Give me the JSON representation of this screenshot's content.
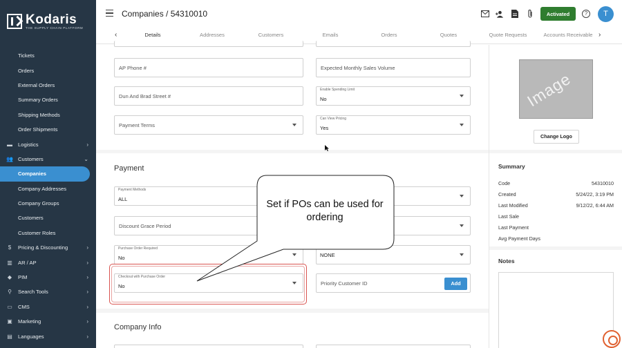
{
  "brand": {
    "name": "Kodaris",
    "tagline": "THE SUPPLY CHAIN PLATFORM"
  },
  "header": {
    "title": "Companies / 54310010",
    "status_button": "Activated",
    "avatar_initial": "T",
    "icons": [
      "menu-icon",
      "mail-icon",
      "user-add-icon",
      "document-icon",
      "attachment-icon",
      "help-icon"
    ]
  },
  "tabs": [
    "Details",
    "Addresses",
    "Customers",
    "Emails",
    "Orders",
    "Quotes",
    "Quote Requests",
    "Accounts Receivable"
  ],
  "sidebar": {
    "items": [
      {
        "label": "Tickets",
        "type": "sub"
      },
      {
        "label": "Orders",
        "type": "sub"
      },
      {
        "label": "External Orders",
        "type": "sub"
      },
      {
        "label": "Summary Orders",
        "type": "sub"
      },
      {
        "label": "Shipping Methods",
        "type": "sub"
      },
      {
        "label": "Order Shipments",
        "type": "sub"
      },
      {
        "label": "Logistics",
        "type": "top",
        "icon": "truck-icon",
        "chevron": "›"
      },
      {
        "label": "Customers",
        "type": "top",
        "icon": "people-icon",
        "chevron": "⌄"
      },
      {
        "label": "Companies",
        "type": "sub",
        "active": true
      },
      {
        "label": "Company Addresses",
        "type": "sub"
      },
      {
        "label": "Company Groups",
        "type": "sub"
      },
      {
        "label": "Customers",
        "type": "sub"
      },
      {
        "label": "Customer Roles",
        "type": "sub"
      },
      {
        "label": "Pricing & Discounting",
        "type": "top",
        "icon": "dollar-icon",
        "chevron": "›"
      },
      {
        "label": "AR / AP",
        "type": "top",
        "icon": "bank-icon",
        "chevron": "›"
      },
      {
        "label": "PIM",
        "type": "top",
        "icon": "tag-icon",
        "chevron": "›"
      },
      {
        "label": "Search Tools",
        "type": "top",
        "icon": "search-icon",
        "chevron": "›"
      },
      {
        "label": "CMS",
        "type": "top",
        "icon": "cms-icon",
        "chevron": "›"
      },
      {
        "label": "Marketing",
        "type": "top",
        "icon": "marketing-icon",
        "chevron": "›"
      },
      {
        "label": "Languages",
        "type": "top",
        "icon": "language-icon",
        "chevron": "›"
      }
    ]
  },
  "form": {
    "ap_phone": {
      "placeholder": "AP Phone #"
    },
    "expected_sales": {
      "placeholder": "Expected Monthly Sales Volume"
    },
    "dun_bradstreet": {
      "placeholder": "Dun And Brad Street #"
    },
    "spending_limit": {
      "label": "Enable Spending Limit",
      "value": "No"
    },
    "payment_terms": {
      "placeholder": "Payment Terms"
    },
    "can_view_pricing": {
      "label": "Can View Pricing",
      "value": "Yes"
    },
    "payment_section": "Payment",
    "payment_methods": {
      "label": "Payment Methods",
      "value": "ALL"
    },
    "discount_grace": {
      "placeholder": "Discount Grace Period"
    },
    "po_required": {
      "label": "Purchase Order Required",
      "value": "No"
    },
    "right_none": {
      "value": "NONE"
    },
    "checkout_po": {
      "label": "Checkout with Purchase Order",
      "value": "No"
    },
    "priority_customer": {
      "placeholder": "Priority Customer ID",
      "button": "Add"
    },
    "company_info_section": "Company Info"
  },
  "right_panel": {
    "image_placeholder": "Image",
    "change_logo": "Change Logo",
    "summary_title": "Summary",
    "summary": [
      {
        "k": "Code",
        "v": "54310010"
      },
      {
        "k": "Created",
        "v": "5/24/22, 3:19 PM"
      },
      {
        "k": "Last Modified",
        "v": "9/12/22, 6:44 AM"
      },
      {
        "k": "Last Sale",
        "v": ""
      },
      {
        "k": "Last Payment",
        "v": ""
      },
      {
        "k": "Avg Payment Days",
        "v": ""
      }
    ],
    "notes_title": "Notes"
  },
  "callout": {
    "text": "Set if POs can be used for ordering"
  },
  "colors": {
    "sidebar": "#263645",
    "accent": "#3a8fd0",
    "activated": "#2f7d2f",
    "highlight": "#d9534f"
  }
}
